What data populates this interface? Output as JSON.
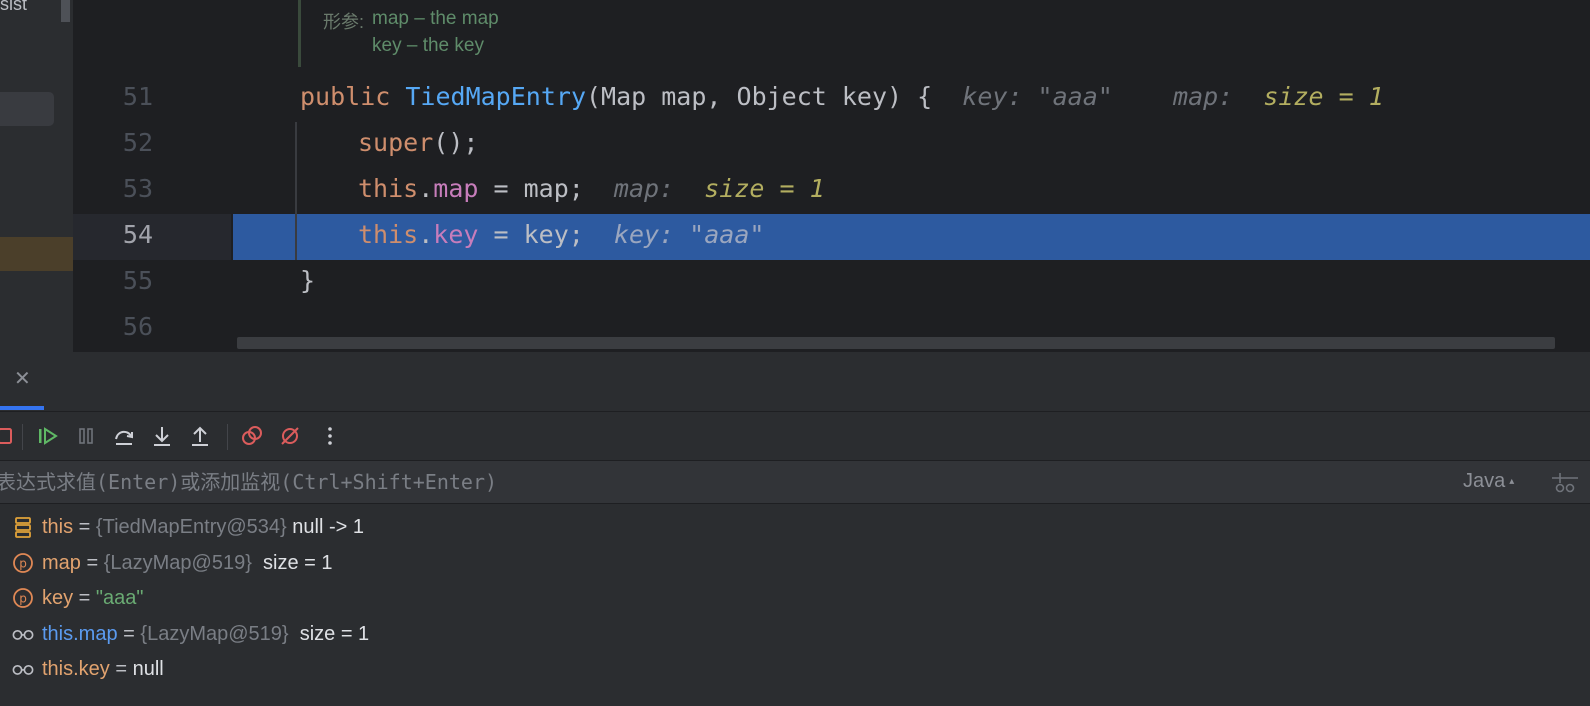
{
  "project_panel": {
    "partial_text": "sist"
  },
  "editor": {
    "doc_comment": {
      "label": "形参:",
      "params": [
        "map – the map",
        "key – the key"
      ]
    },
    "lines": [
      {
        "num": "51",
        "kw": "public",
        "fn": "TiedMapEntry",
        "rest": "(Map map, Object key) {",
        "hint1": "key: \"aaa\"",
        "hint2_label": "map:",
        "hint2_value": "size = 1"
      },
      {
        "num": "52",
        "kw": "super",
        "rest": "();"
      },
      {
        "num": "53",
        "kw": "this",
        "dot": ".",
        "field": "map",
        "rest": " = map;",
        "hint_label": "map:",
        "hint_value": "size = 1"
      },
      {
        "num": "54",
        "kw": "this",
        "dot": ".",
        "field": "key",
        "rest": " = key;",
        "hint": "key: \"aaa\""
      },
      {
        "num": "55",
        "rest": "}"
      },
      {
        "num": "56"
      }
    ]
  },
  "debug": {
    "eval_placeholder": "表达式求值(Enter)或添加监视(Ctrl+Shift+Enter)",
    "language": "Java",
    "variables": [
      {
        "icon": "object-stack-icon",
        "name": "this",
        "eq": " = ",
        "ref": "{TiedMapEntry@534}",
        "value": " null -> 1"
      },
      {
        "icon": "parameter-icon",
        "name": "map",
        "eq": " = ",
        "ref": "{LazyMap@519}",
        "value": "  size = 1"
      },
      {
        "icon": "parameter-icon",
        "name": "key",
        "eq": " = ",
        "str": "\"aaa\""
      },
      {
        "icon": "watch-icon",
        "name": "this.map",
        "eq": " = ",
        "ref": "{LazyMap@519}",
        "value": "  size = 1"
      },
      {
        "icon": "watch-icon",
        "name": "this.key",
        "eq": " = ",
        "value": "null"
      }
    ]
  },
  "colors": {
    "editor_bg": "#1e1f22",
    "panel_bg": "#2b2d30",
    "execution_line": "#2d5aa0",
    "keyword": "#cf8e6d",
    "function": "#56a8f5",
    "field": "#c77dbb",
    "string": "#6aab73"
  }
}
